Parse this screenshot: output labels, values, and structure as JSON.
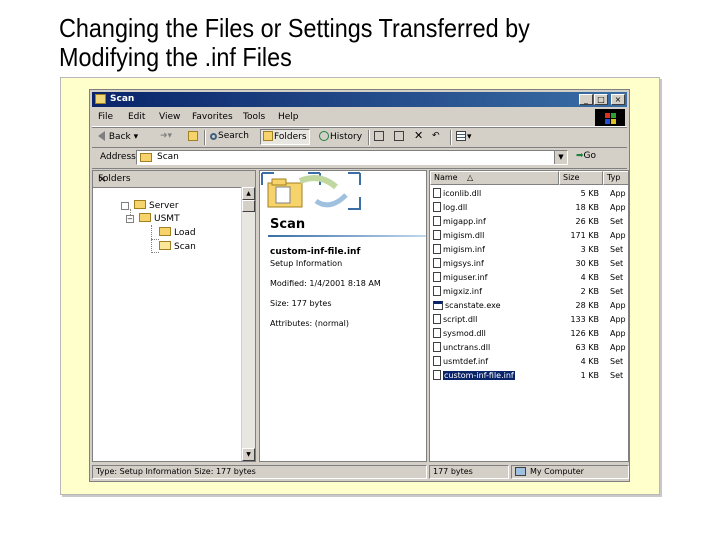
{
  "slide": {
    "title_line1": "Changing the Files or Settings Transferred by",
    "title_line2": "Modifying the .inf Files"
  },
  "window": {
    "title": "Scan",
    "controls": {
      "minimize": "_",
      "maximize": "□",
      "close": "×"
    }
  },
  "menu": [
    "File",
    "Edit",
    "View",
    "Favorites",
    "Tools",
    "Help"
  ],
  "toolbar": {
    "back": "Back",
    "search": "Search",
    "folders": "Folders",
    "history": "History"
  },
  "address": {
    "label": "Address",
    "value": "Scan",
    "go": "Go"
  },
  "folders_pane": {
    "header": "Folders",
    "close": "×",
    "tree": [
      {
        "label": "Server"
      },
      {
        "label": "USMT"
      },
      {
        "label": "Load"
      },
      {
        "label": "Scan"
      }
    ]
  },
  "webview": {
    "title": "Scan",
    "file_name": "custom-inf-file.inf",
    "file_type": "Setup Information",
    "modified": "Modified: 1/4/2001 8:18 AM",
    "size": "Size: 177 bytes",
    "attributes": "Attributes: (normal)"
  },
  "file_list": {
    "columns": {
      "name": "Name",
      "size": "Size",
      "type": "Typ"
    },
    "files": [
      {
        "name": "iconlib.dll",
        "size": "5 KB",
        "type": "App",
        "icon": "dll-icon"
      },
      {
        "name": "log.dll",
        "size": "18 KB",
        "type": "App",
        "icon": "dll-icon"
      },
      {
        "name": "migapp.inf",
        "size": "26 KB",
        "type": "Set",
        "icon": "inf-icon"
      },
      {
        "name": "migism.dll",
        "size": "171 KB",
        "type": "App",
        "icon": "dll-icon"
      },
      {
        "name": "migism.inf",
        "size": "3 KB",
        "type": "Set",
        "icon": "inf-icon"
      },
      {
        "name": "migsys.inf",
        "size": "30 KB",
        "type": "Set",
        "icon": "inf-icon"
      },
      {
        "name": "miguser.inf",
        "size": "4 KB",
        "type": "Set",
        "icon": "inf-icon"
      },
      {
        "name": "migxiz.inf",
        "size": "2 KB",
        "type": "Set",
        "icon": "inf-icon"
      },
      {
        "name": "scanstate.exe",
        "size": "28 KB",
        "type": "App",
        "icon": "exe-icon"
      },
      {
        "name": "script.dll",
        "size": "133 KB",
        "type": "App",
        "icon": "dll-icon"
      },
      {
        "name": "sysmod.dll",
        "size": "126 KB",
        "type": "App",
        "icon": "dll-icon"
      },
      {
        "name": "unctrans.dll",
        "size": "63 KB",
        "type": "App",
        "icon": "dll-icon"
      },
      {
        "name": "usmtdef.inf",
        "size": "4 KB",
        "type": "Set",
        "icon": "inf-icon"
      },
      {
        "name": "custom-inf-file.inf",
        "size": "1 KB",
        "type": "Set",
        "icon": "inf-icon",
        "selected": true
      }
    ]
  },
  "statusbar": {
    "type_info": "Type: Setup Information Size: 177 bytes",
    "size": "177 bytes",
    "location": "My Computer"
  },
  "colors": {
    "frame_bg": "#ffffcc",
    "titlebar_start": "#0a246a",
    "titlebar_end": "#3a6ea5",
    "window_face": "#d4d0c8",
    "selection": "#0a246a"
  }
}
